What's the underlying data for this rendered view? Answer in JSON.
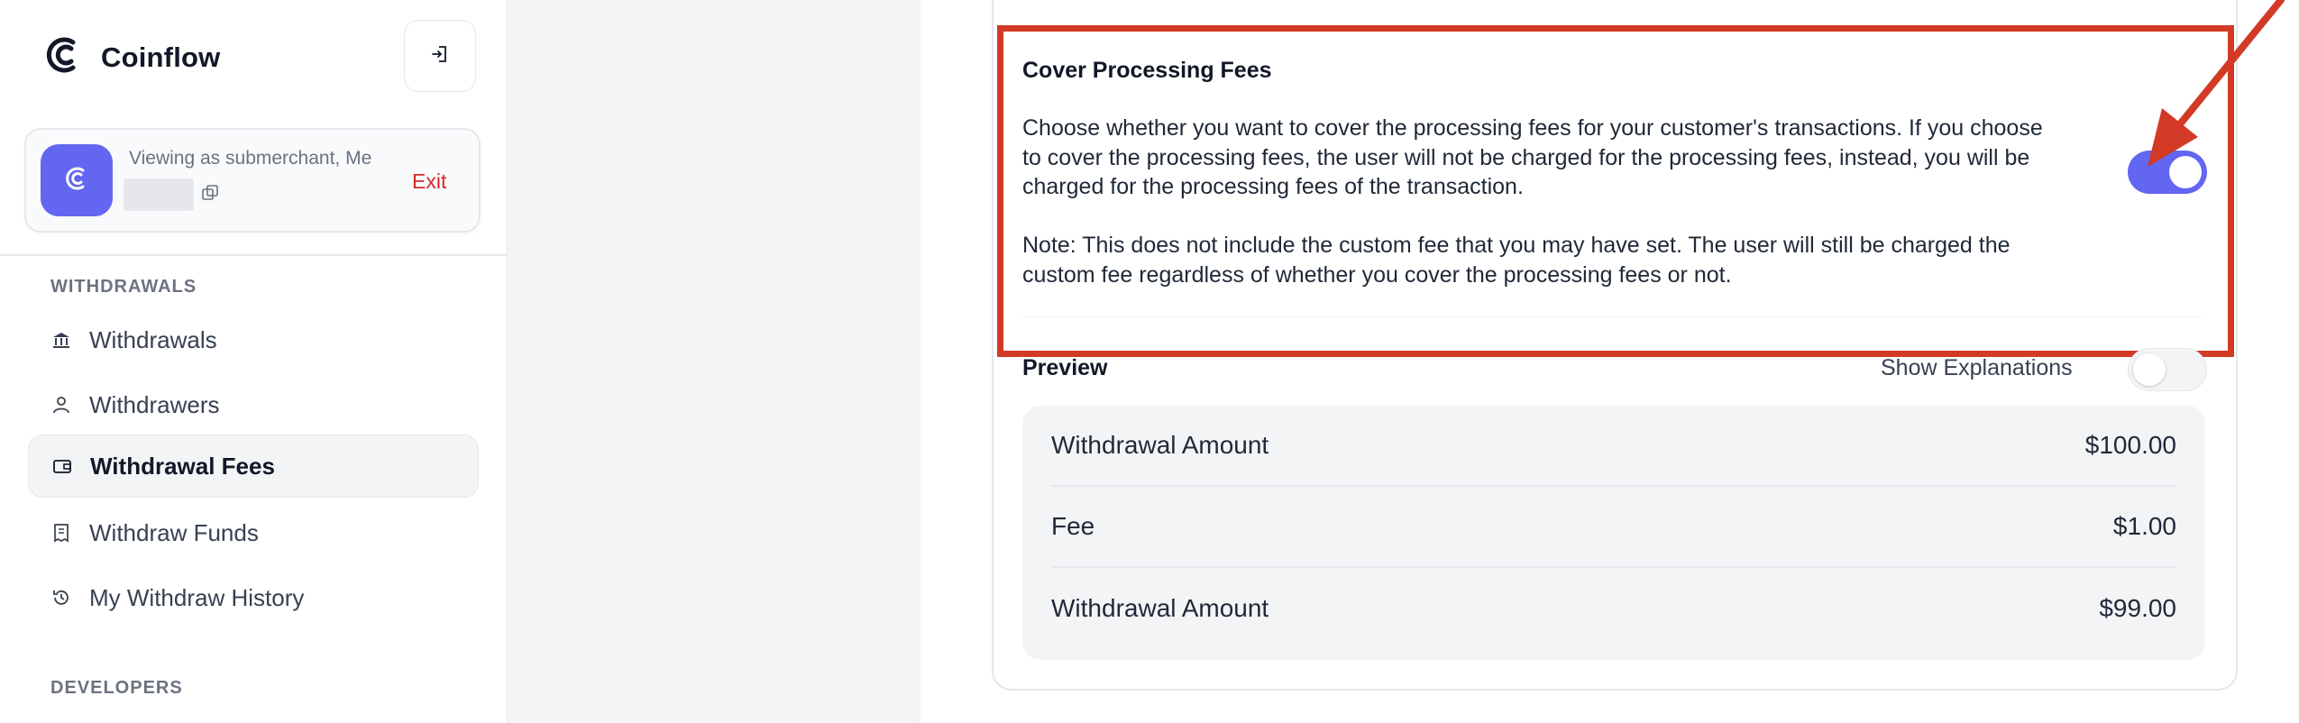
{
  "brand": {
    "name": "Coinflow",
    "accent": "#6366f1"
  },
  "merchant": {
    "viewing_label": "Viewing as submerchant, Me",
    "exit_label": "Exit"
  },
  "sidebar": {
    "sections": [
      {
        "heading": "WITHDRAWALS"
      },
      {
        "heading": "DEVELOPERS"
      }
    ],
    "items": [
      {
        "label": "Withdrawals",
        "icon": "bank-icon",
        "active": false
      },
      {
        "label": "Withdrawers",
        "icon": "user-icon",
        "active": false
      },
      {
        "label": "Withdrawal Fees",
        "icon": "wallet-icon",
        "active": true
      },
      {
        "label": "Withdraw Funds",
        "icon": "receipt-icon",
        "active": false
      },
      {
        "label": "My Withdraw History",
        "icon": "history-icon",
        "active": false
      }
    ]
  },
  "setting": {
    "title": "Cover Processing Fees",
    "description": "Choose whether you want to cover the processing fees for your customer's transactions. If you choose to cover the processing fees, the user will not be charged for the processing fees, instead, you will be charged for the processing fees of the transaction.",
    "note": "Note: This does not include the custom fee that you may have set. The user will still be charged the custom fee regardless of whether you cover the processing fees or not.",
    "enabled": true
  },
  "preview": {
    "title": "Preview",
    "show_explanations_label": "Show Explanations",
    "show_explanations_enabled": false,
    "rows": [
      {
        "label": "Withdrawal Amount",
        "value": "$100.00"
      },
      {
        "label": "Fee",
        "value": "$1.00"
      },
      {
        "label": "Withdrawal Amount",
        "value": "$99.00"
      }
    ]
  },
  "annotation_color": "#d23a26"
}
